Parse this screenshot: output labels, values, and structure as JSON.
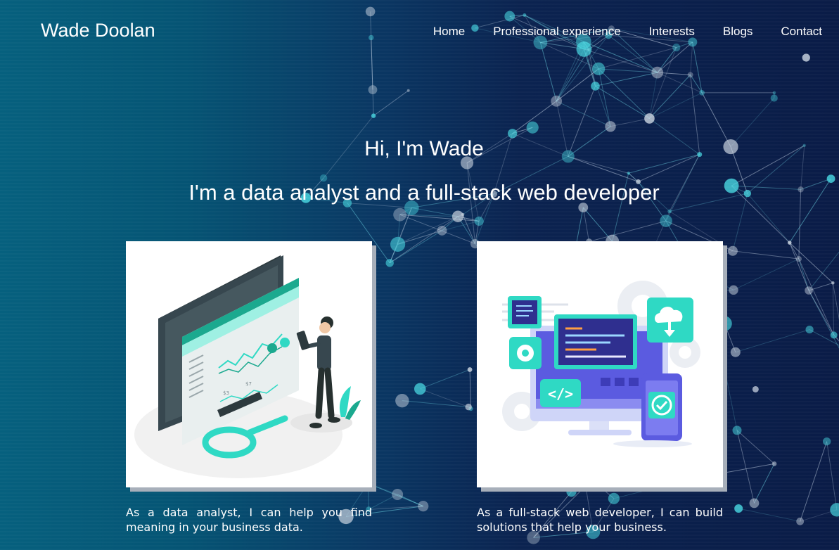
{
  "header": {
    "brand": "Wade Doolan",
    "nav": [
      "Home",
      "Professional experience",
      "Interests",
      "Blogs",
      "Contact"
    ]
  },
  "hero": {
    "greeting": "Hi, I'm Wade",
    "tagline": "I'm a data analyst and a full-stack web developer"
  },
  "services": [
    {
      "illustration": "data-analyst-dashboard-illustration",
      "caption": "As a data analyst, I can help you find meaning in your business data."
    },
    {
      "illustration": "web-developer-devices-illustration",
      "caption": "As a full-stack web developer, I can build solutions that help your business."
    }
  ],
  "colors": {
    "background_left": "#06607e",
    "background_right": "#0a1c47",
    "accent_teal": "#2fd9c4",
    "accent_purple": "#5b5be0",
    "text": "#ffffff"
  }
}
